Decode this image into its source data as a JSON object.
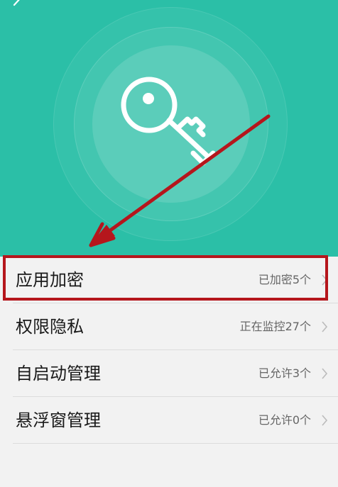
{
  "header": {
    "back_icon": "chevron-left-icon",
    "hero_icon": "key-icon",
    "accent_color": "#2bbfa7"
  },
  "list": {
    "items": [
      {
        "label": "应用加密",
        "status": "已加密5个"
      },
      {
        "label": "权限隐私",
        "status": "正在监控27个"
      },
      {
        "label": "自启动管理",
        "status": "已允许3个"
      },
      {
        "label": "悬浮窗管理",
        "status": "已允许0个"
      }
    ]
  },
  "annotation": {
    "highlight_color": "#b5161c"
  }
}
